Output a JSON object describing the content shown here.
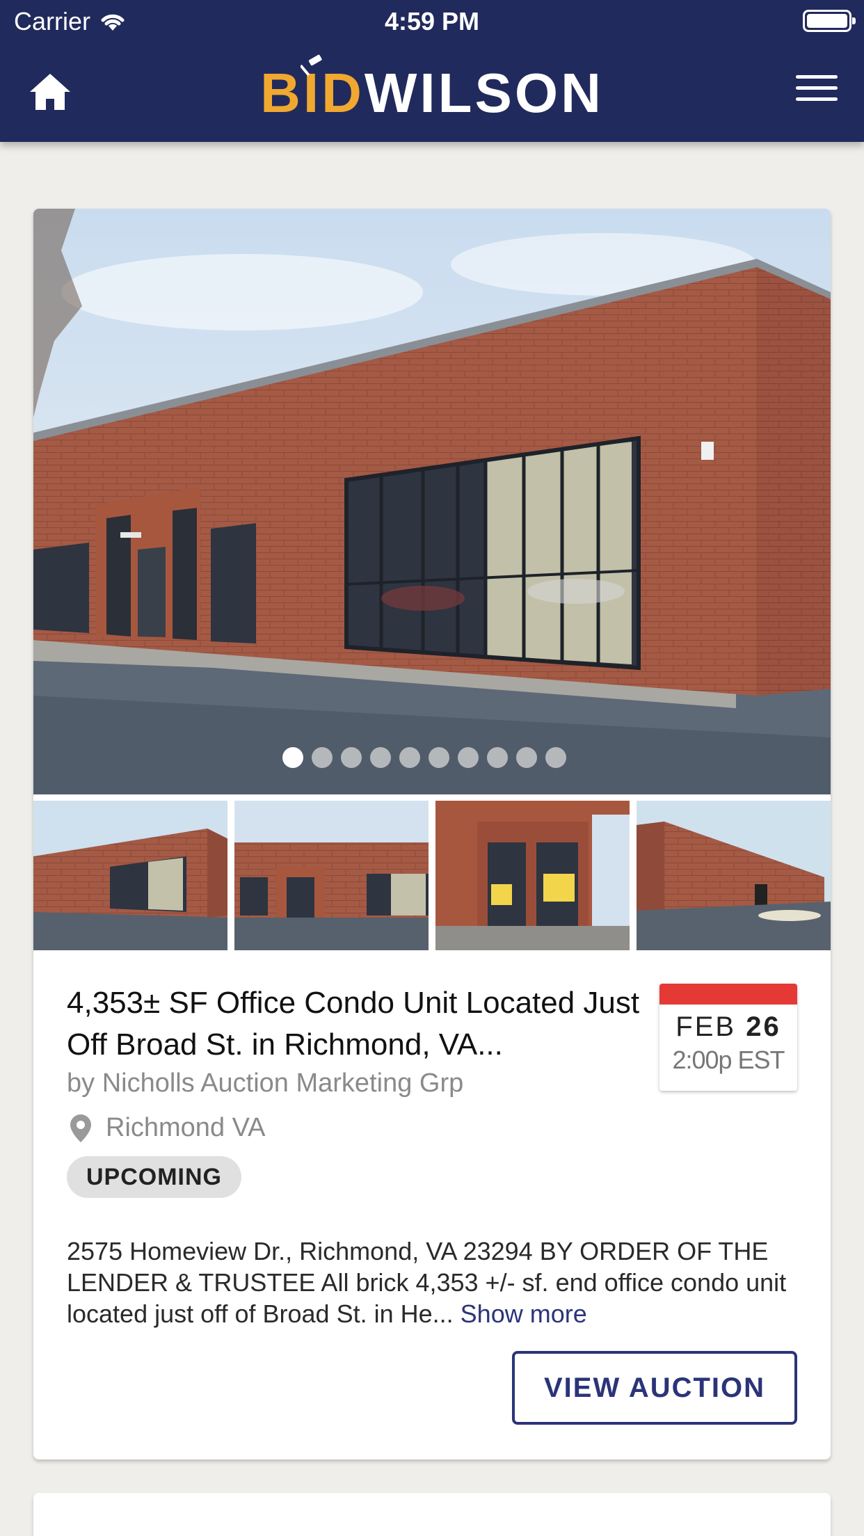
{
  "status_bar": {
    "carrier": "Carrier",
    "time": "4:59 PM"
  },
  "header": {
    "logo_part1": "BID",
    "logo_part2": "WILSON",
    "home_icon": "home-icon",
    "menu_icon": "hamburger-menu-icon",
    "background_color": "#212a5c",
    "logo_accent_color": "#f0a830"
  },
  "listing": {
    "title": "4,353± SF Office Condo Unit Located Just Off Broad St. in Richmond, VA...",
    "byline": "by Nicholls Auction Marketing Grp",
    "location": "Richmond VA",
    "status": "UPCOMING",
    "date": {
      "month": "FEB",
      "day": "26",
      "time": "2:00p EST"
    },
    "description": "2575 Homeview Dr., Richmond, VA 23294 BY ORDER OF THE LENDER & TRUSTEE All brick 4,353 +/- sf. end office condo unit located just off of Broad St. in He...",
    "show_more": "Show more",
    "view_button": "VIEW AUCTION",
    "carousel": {
      "total_images": 10,
      "active_index": 1
    },
    "accent_color": "#2b3478",
    "date_bar_color": "#e53935"
  }
}
